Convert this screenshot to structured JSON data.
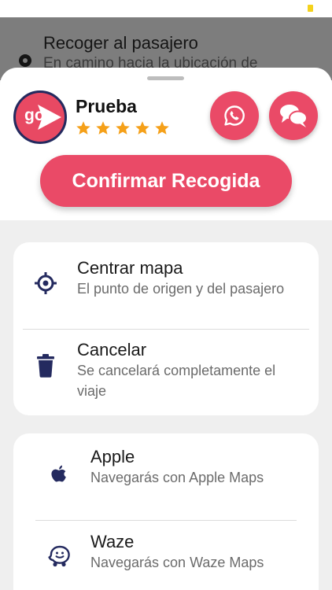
{
  "map_header": {
    "title": "Recoger al pasajero",
    "subtitle": "En camino hacia la ubicación de"
  },
  "driver": {
    "logo_text": "go",
    "name": "Prueba",
    "rating": 5
  },
  "actions": {
    "whatsapp_icon": "whatsapp-icon",
    "chat_icon": "chat-bubbles-icon",
    "confirm_label": "Confirmar Recogida"
  },
  "options": [
    {
      "icon": "crosshair-icon",
      "title": "Centrar mapa",
      "subtitle": "El punto de origen y del pasajero"
    },
    {
      "icon": "trash-icon",
      "title": "Cancelar",
      "subtitle": "Se cancelará completamente el viaje"
    }
  ],
  "navigation": [
    {
      "icon": "apple-icon",
      "title": "Apple",
      "subtitle": "Navegarás con Apple Maps"
    },
    {
      "icon": "waze-icon",
      "title": "Waze",
      "subtitle": "Navegarás con Waze Maps"
    }
  ],
  "colors": {
    "accent": "#ea4a67",
    "navy": "#242a5f",
    "star": "#f5a019",
    "status_battery": "#f4d21d"
  }
}
